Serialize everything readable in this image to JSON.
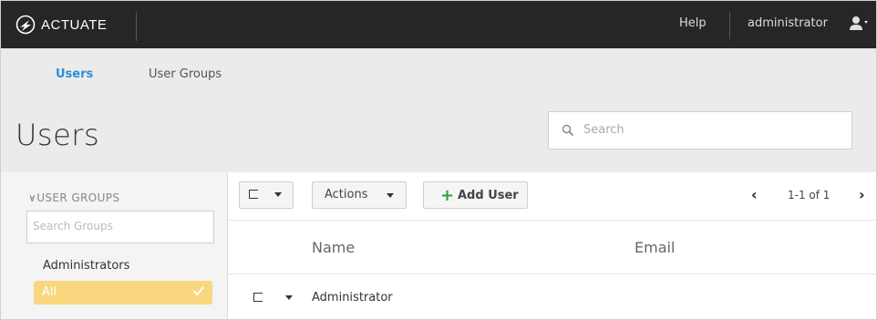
{
  "topbar": {
    "brand": "ACTUATE",
    "help": "Help",
    "username": "administrator"
  },
  "tabs": [
    {
      "label": "Users",
      "active": true
    },
    {
      "label": "User Groups",
      "active": false
    }
  ],
  "page": {
    "title": "Users",
    "search_placeholder": "Search"
  },
  "sidebar": {
    "section_title": "USER GROUPS",
    "search_placeholder": "Search Groups",
    "items": [
      {
        "label": "Administrators",
        "selected": false
      },
      {
        "label": "All",
        "selected": true
      }
    ]
  },
  "toolbar": {
    "actions_label": "Actions",
    "add_user_label": "Add User",
    "pager_text": "1-1 of 1"
  },
  "table": {
    "columns": [
      "Name",
      "Email"
    ],
    "rows": [
      {
        "name": "Administrator",
        "email": ""
      }
    ]
  },
  "colors": {
    "topbar_bg": "#262626",
    "accent_blue": "#2d8fd5",
    "selected_group": "#f9d77f",
    "add_green": "#2e9e3e"
  }
}
